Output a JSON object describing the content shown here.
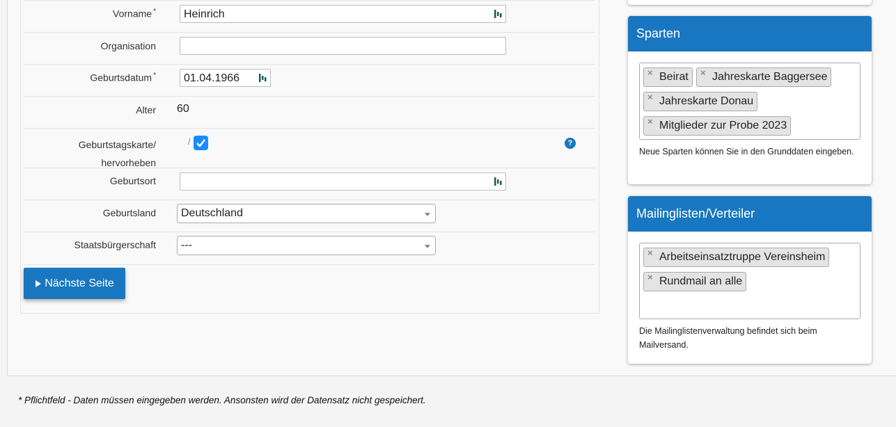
{
  "form": {
    "vorname": {
      "label": "Vorname",
      "required_mark": "*",
      "value": "Heinrich"
    },
    "organisation": {
      "label": "Organisation",
      "value": ""
    },
    "geburtsdatum": {
      "label": "Geburtsdatum",
      "required_mark": "*",
      "value": "01.04.1966"
    },
    "alter": {
      "label": "Alter",
      "value": "60"
    },
    "geburtstagskarte": {
      "label_line1": "Geburtstagskarte/",
      "label_line2": "hervorheben",
      "separator": "/",
      "checked": true,
      "help": "?"
    },
    "geburtsort": {
      "label": "Geburtsort",
      "value": ""
    },
    "geburtsland": {
      "label": "Geburtsland",
      "value": "Deutschland"
    },
    "staatsbuergerschaft": {
      "label": "Staatsbürgerschaft",
      "value": "---"
    },
    "next_button": {
      "icon": "play-icon",
      "label": "Nächste Seite"
    }
  },
  "sparten": {
    "title": "Sparten",
    "tags": [
      "Beirat",
      "Jahreskarte Baggersee",
      "Jahreskarte Donau",
      "Mitglieder zur Probe 2023"
    ],
    "note": "Neue Sparten können Sie in den Grunddaten eingeben."
  },
  "mailinglisten": {
    "title": "Mailinglisten/Verteiler",
    "tags": [
      "Arbeitseinsatztruppe Vereinsheim",
      "Rundmail an alle"
    ],
    "note": "Die Mailinglistenverwaltung befindet sich beim Mailversand."
  },
  "footnote": "* Pflichtfeld - Daten müssen eingegeben werden. Ansonsten wird der Datensatz nicht gespeichert.",
  "colors": {
    "accent": "#1877c0",
    "checkbox": "#1a8cff"
  }
}
